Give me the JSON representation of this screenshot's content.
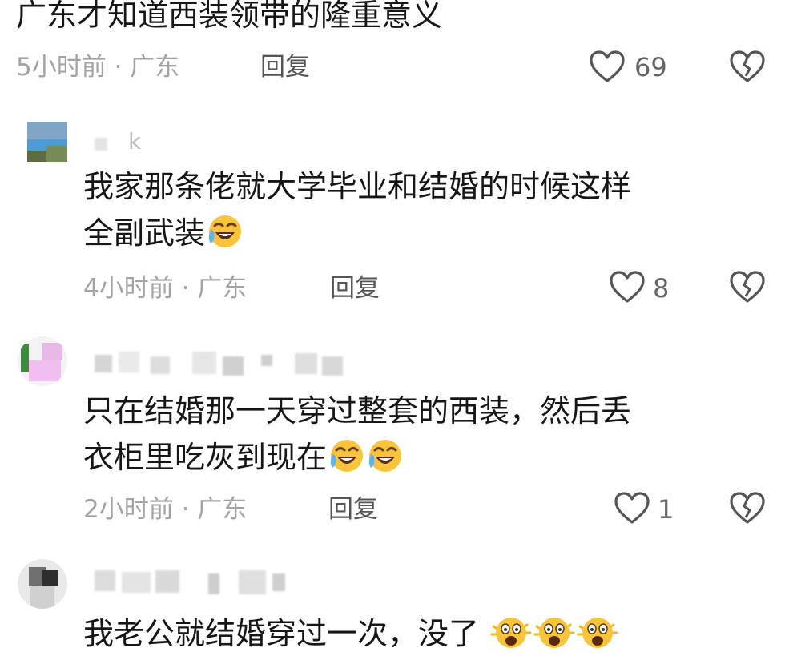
{
  "comments": [
    {
      "text_lines": [
        "广东才知道西装领带的隆重意义"
      ],
      "time": "5小时前",
      "location": "广东",
      "reply_label": "回复",
      "likes": "69"
    },
    {
      "username": "k",
      "text_lines": [
        "我家那条佬就大学毕业和结婚的时候这样",
        "全副武装"
      ],
      "emoji_count": 1,
      "time": "4小时前",
      "location": "广东",
      "reply_label": "回复",
      "likes": "8"
    },
    {
      "text_lines": [
        "只在结婚那一天穿过整套的西装，然后丢",
        "衣柜里吃灰到现在"
      ],
      "emoji_count": 2,
      "time": "2小时前",
      "location": "广东",
      "reply_label": "回复",
      "likes": "1"
    },
    {
      "text_lines": [
        "我老公就结婚穿过一次，没了"
      ],
      "emoji_count": 3
    }
  ],
  "separator": " · ",
  "icons": {
    "like": "heart-outline-icon",
    "dislike": "broken-heart-icon",
    "laugh": "laughing-crying-emoji-icon",
    "surprise": "astonished-emoji-icon"
  },
  "colors": {
    "text": "#161616",
    "meta": "#a3a3a3",
    "icon": "#555555"
  }
}
